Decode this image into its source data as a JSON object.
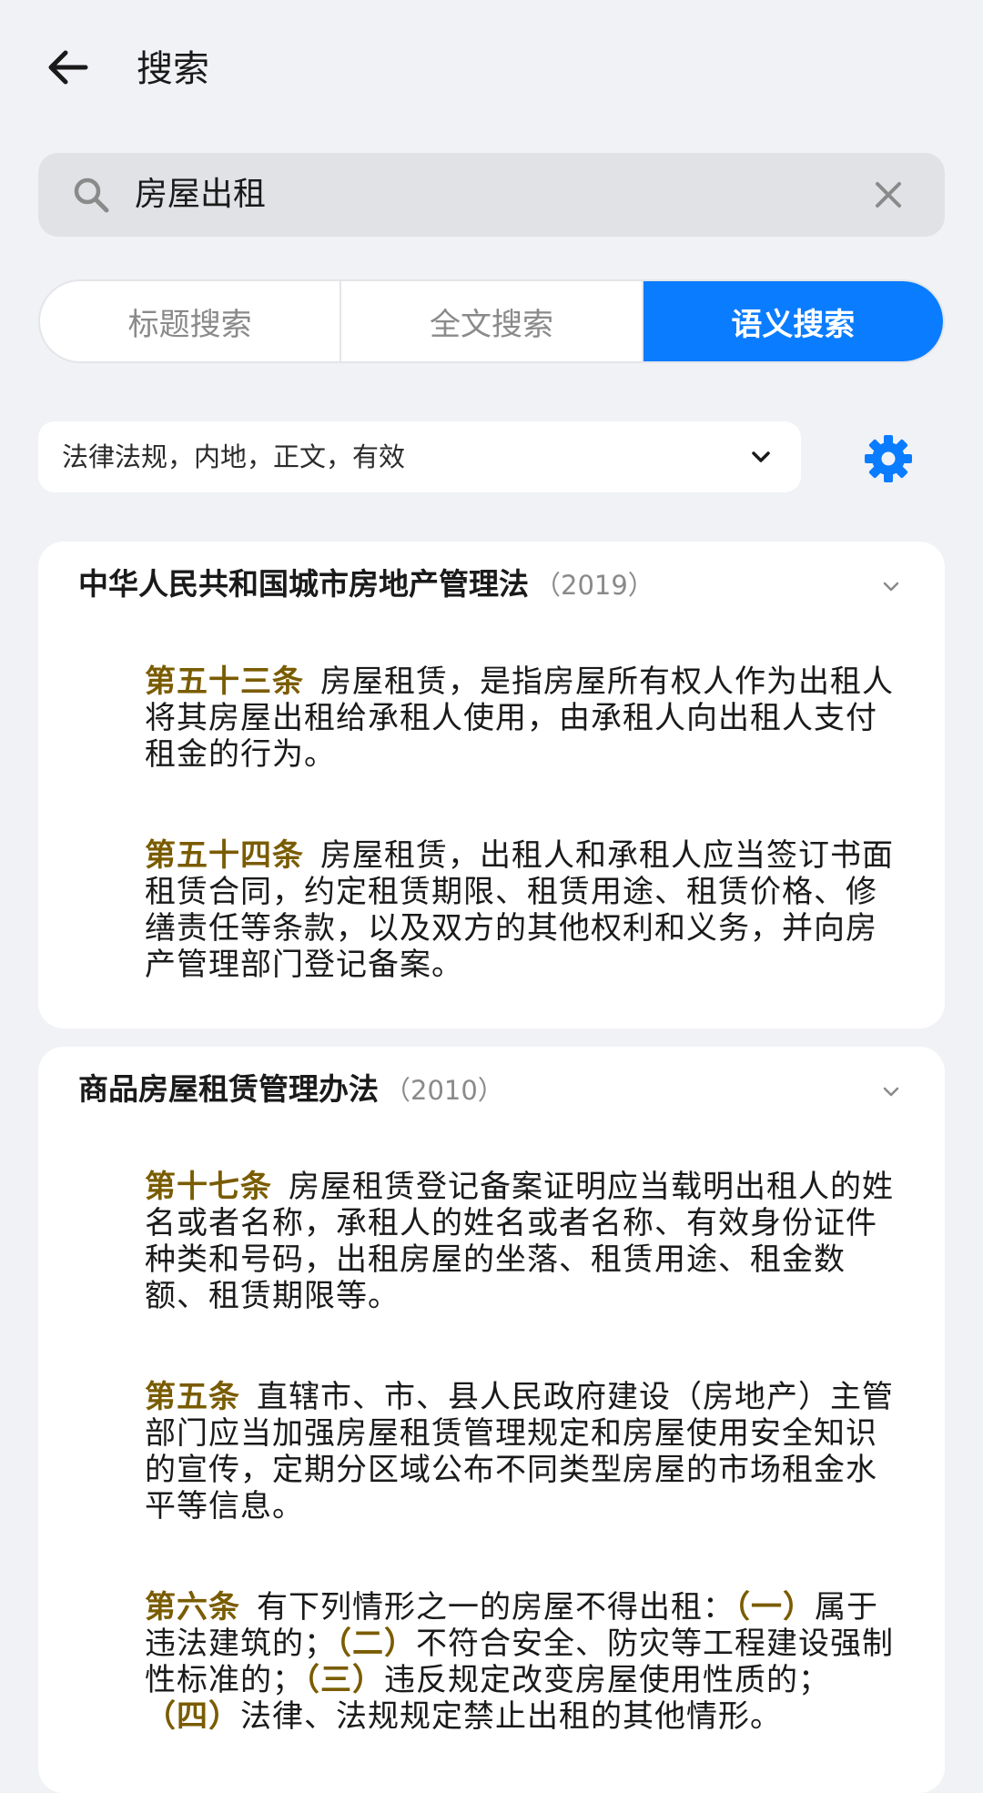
{
  "header": {
    "title": "搜索"
  },
  "search": {
    "query": "房屋出租"
  },
  "tabs": [
    {
      "label": "标题搜索",
      "active": false
    },
    {
      "label": "全文搜索",
      "active": false
    },
    {
      "label": "语义搜索",
      "active": true
    }
  ],
  "filter": {
    "label": "法律法规，内地，正文，有效"
  },
  "colors": {
    "accent": "#0a7cff",
    "article_no": "#7a5c00",
    "year": "#8a8a8a"
  },
  "results": [
    {
      "title": "中华人民共和国城市房地产管理法",
      "year": "（2019）",
      "articles": [
        {
          "no": "第五十三条",
          "text": "房屋租赁，是指房屋所有权人作为出租人将其房屋出租给承租人使用，由承租人向出租人支付租金的行为。"
        },
        {
          "no": "第五十四条",
          "text": "房屋租赁，出租人和承租人应当签订书面租赁合同，约定租赁期限、租赁用途、租赁价格、修缮责任等条款，以及双方的其他权利和义务，并向房产管理部门登记备案。"
        }
      ]
    },
    {
      "title": "商品房屋租赁管理办法",
      "year": "（2010）",
      "articles": [
        {
          "no": "第十七条",
          "text": "房屋租赁登记备案证明应当载明出租人的姓名或者名称，承租人的姓名或者名称、有效身份证件种类和号码，出租房屋的坐落、租赁用途、租金数额、租赁期限等。"
        },
        {
          "no": "第五条",
          "text": "直辖市、市、县人民政府建设（房地产）主管部门应当加强房屋租赁管理规定和房屋使用安全知识的宣传，定期分区域公布不同类型房屋的市场租金水平等信息。"
        },
        {
          "no": "第六条",
          "intro": "有下列情形之一的房屋不得出租：",
          "items": [
            {
              "mark": "（一）",
              "text": "属于违法建筑的；"
            },
            {
              "mark": "（二）",
              "text": "不符合安全、防灾等工程建设强制性标准的；"
            },
            {
              "mark": "（三）",
              "text": "违反规定改变房屋使用性质的；"
            },
            {
              "mark": "（四）",
              "text": "法律、法规规定禁止出租的其他情形。"
            }
          ]
        }
      ]
    }
  ]
}
